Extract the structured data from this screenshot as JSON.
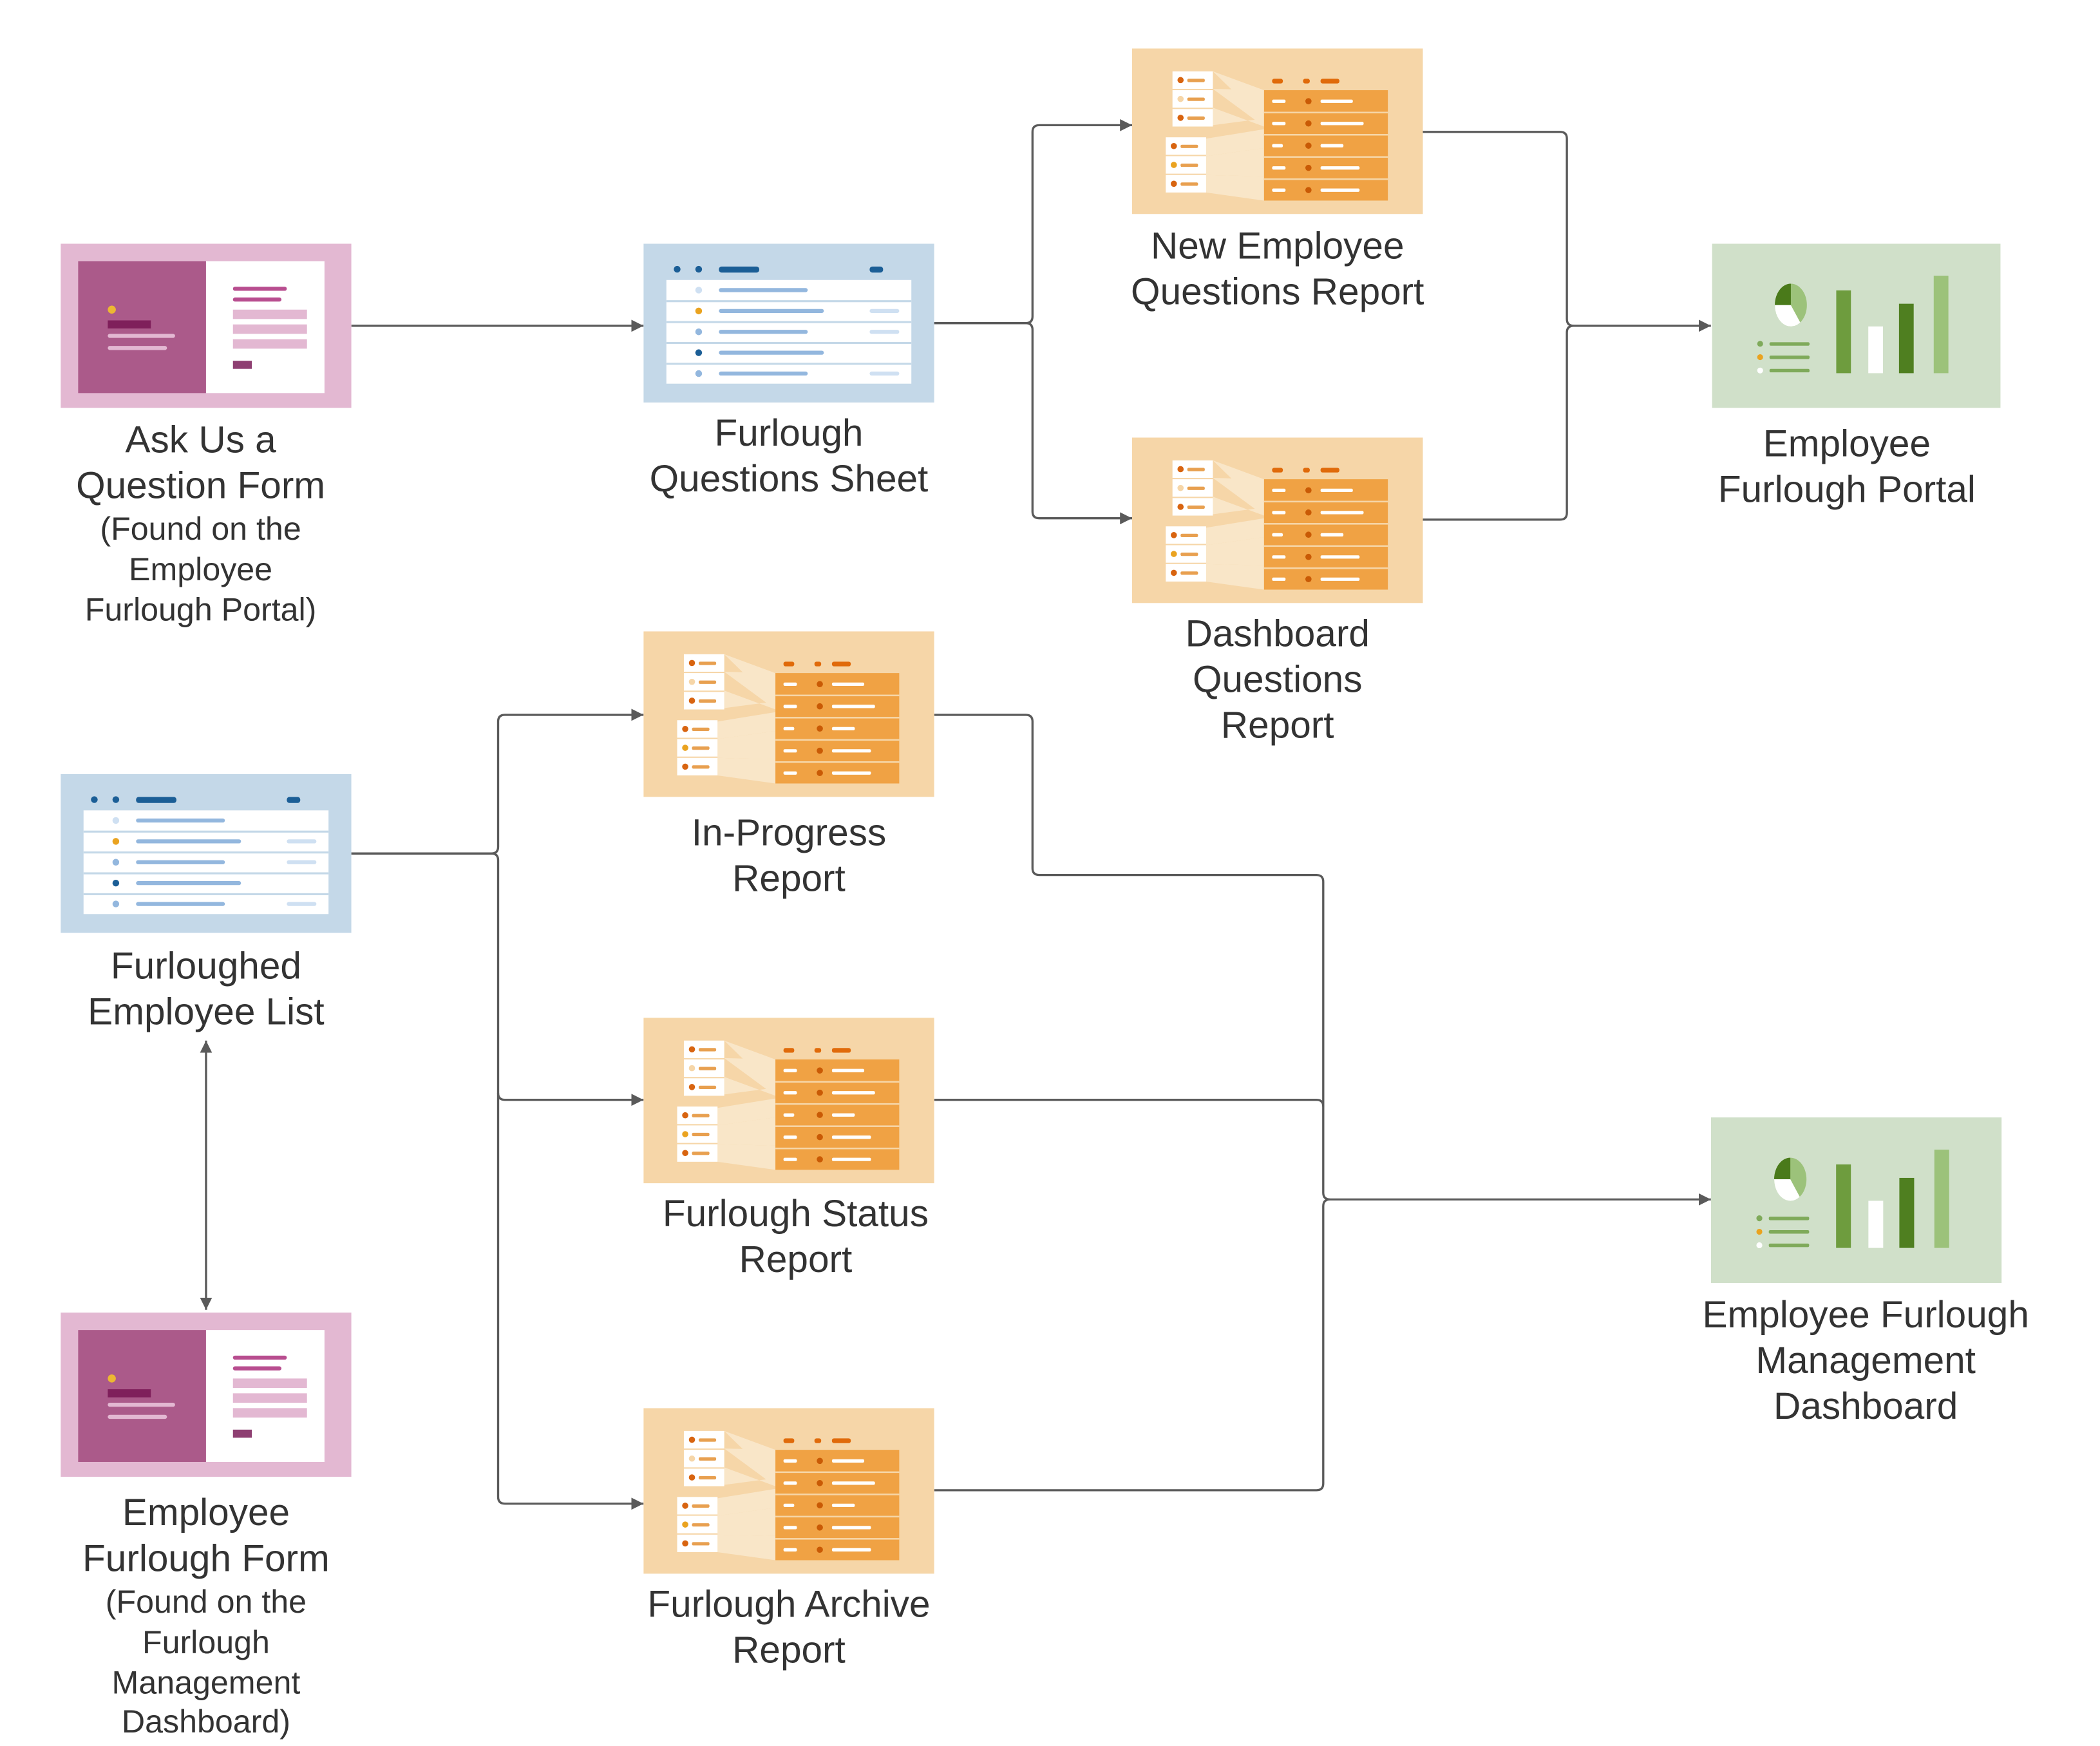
{
  "colors": {
    "form_bg": "#e3b8d2",
    "sheet_bg": "#c4d8e8",
    "report_bg": "#f6d6a8",
    "dashboard_bg": "#d0e0c9",
    "connector": "#5a5a5a",
    "text": "#333333"
  },
  "nodes": {
    "ask_form": {
      "icon": "form-icon",
      "title": [
        "Ask Us a",
        "Question Form"
      ],
      "note": [
        "(Found on the",
        "Employee",
        "Furlough Portal)"
      ]
    },
    "questions_sheet": {
      "icon": "sheet-icon",
      "title": [
        "Furlough",
        "Questions Sheet"
      ]
    },
    "new_employee_report": {
      "icon": "report-icon",
      "title": [
        "New Employee",
        "Questions Report"
      ]
    },
    "dashboard_questions_report": {
      "icon": "report-icon",
      "title": [
        "Dashboard",
        "Questions",
        "Report"
      ]
    },
    "employee_portal": {
      "icon": "dashboard-icon",
      "title": [
        "Employee",
        "Furlough Portal"
      ]
    },
    "furloughed_list": {
      "icon": "sheet-icon",
      "title": [
        "Furloughed",
        "Employee List"
      ]
    },
    "furlough_form": {
      "icon": "form-icon",
      "title": [
        "Employee",
        "Furlough Form"
      ],
      "note": [
        "(Found on the",
        "Furlough",
        "Management",
        "Dashboard)"
      ]
    },
    "in_progress_report": {
      "icon": "report-icon",
      "title": [
        "In-Progress",
        "Report"
      ]
    },
    "status_report": {
      "icon": "report-icon",
      "title": [
        "Furlough Status",
        "Report"
      ]
    },
    "archive_report": {
      "icon": "report-icon",
      "title": [
        "Furlough Archive",
        "Report"
      ]
    },
    "management_dashboard": {
      "icon": "dashboard-icon",
      "title": [
        "Employee Furlough",
        "Management",
        "Dashboard"
      ]
    }
  },
  "edges": [
    {
      "from": "ask_form",
      "to": "questions_sheet"
    },
    {
      "from": "questions_sheet",
      "to": "new_employee_report"
    },
    {
      "from": "questions_sheet",
      "to": "dashboard_questions_report"
    },
    {
      "from": "new_employee_report",
      "to": "employee_portal"
    },
    {
      "from": "dashboard_questions_report",
      "to": "employee_portal"
    },
    {
      "from": "furloughed_list",
      "to": "in_progress_report"
    },
    {
      "from": "furloughed_list",
      "to": "status_report"
    },
    {
      "from": "furloughed_list",
      "to": "archive_report"
    },
    {
      "from": "in_progress_report",
      "to": "management_dashboard"
    },
    {
      "from": "status_report",
      "to": "management_dashboard"
    },
    {
      "from": "archive_report",
      "to": "management_dashboard"
    },
    {
      "from": "furloughed_list",
      "to": "furlough_form",
      "bidirectional": true
    }
  ]
}
